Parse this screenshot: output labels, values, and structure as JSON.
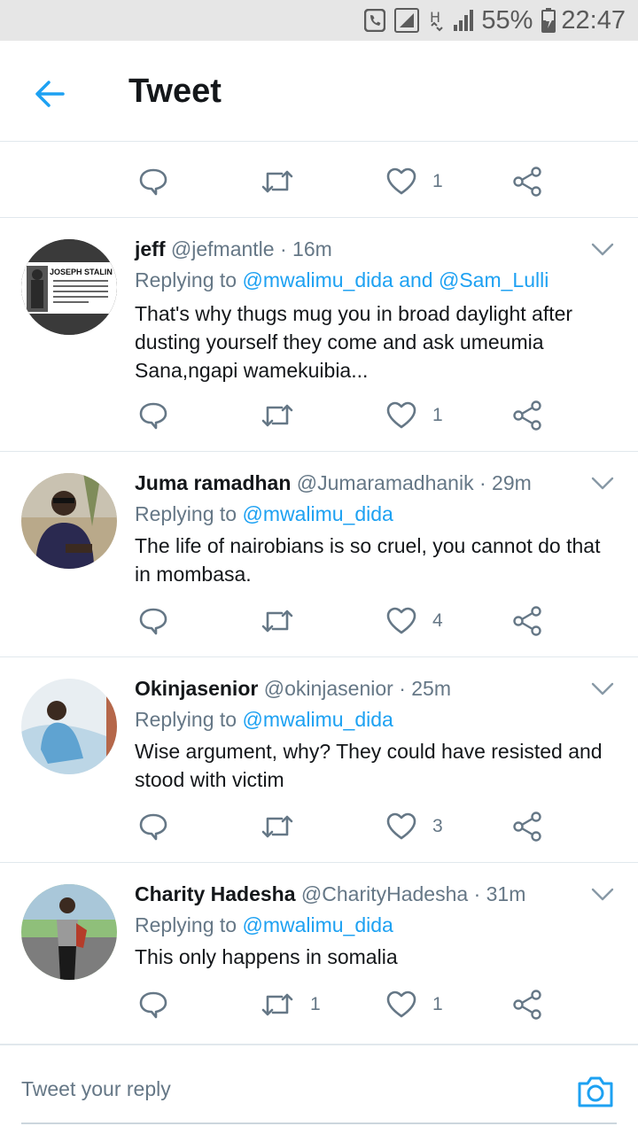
{
  "status_bar": {
    "battery": "55%",
    "time": "22:47",
    "network": "H"
  },
  "header": {
    "title": "Tweet"
  },
  "top_actions": {
    "like_count": "1"
  },
  "tweets": [
    {
      "name": "jeff",
      "handle": "@jefmantle",
      "dot": "·",
      "time": "16m",
      "replying_prefix": "Replying to",
      "mentions": "@mwalimu_dida and @Sam_Lulli",
      "text": "That's why thugs mug you in broad daylight after dusting yourself they come and ask umeumia Sana,ngapi wamekuibia...",
      "retweet_count": "",
      "like_count": "1",
      "avatar_caption": "JOSEPH STALIN"
    },
    {
      "name": "Juma ramadhan",
      "handle": "@Jumaramadhanik",
      "dot": "·",
      "time": "29m",
      "replying_prefix": "Replying to",
      "mentions": "@mwalimu_dida",
      "text": "The life of nairobians is so cruel, you cannot do that in mombasa.",
      "retweet_count": "",
      "like_count": "4"
    },
    {
      "name": "Okinjasenior",
      "handle": "@okinjasenior",
      "dot": "·",
      "time": "25m",
      "replying_prefix": "Replying to",
      "mentions": "@mwalimu_dida",
      "text": "Wise argument, why? They could have resisted and stood with victim",
      "retweet_count": "",
      "like_count": "3"
    },
    {
      "name": "Charity Hadesha",
      "handle": "@CharityHadesha",
      "dot": "·",
      "time": "31m",
      "replying_prefix": "Replying to",
      "mentions": "@mwalimu_dida",
      "text": "This only happens in somalia",
      "retweet_count": "1",
      "like_count": "1"
    }
  ],
  "reply_bar": {
    "placeholder": "Tweet your reply"
  },
  "colors": {
    "accent": "#1da1f2",
    "muted": "#657786",
    "text": "#14171a",
    "divider": "#e1e8ed"
  }
}
